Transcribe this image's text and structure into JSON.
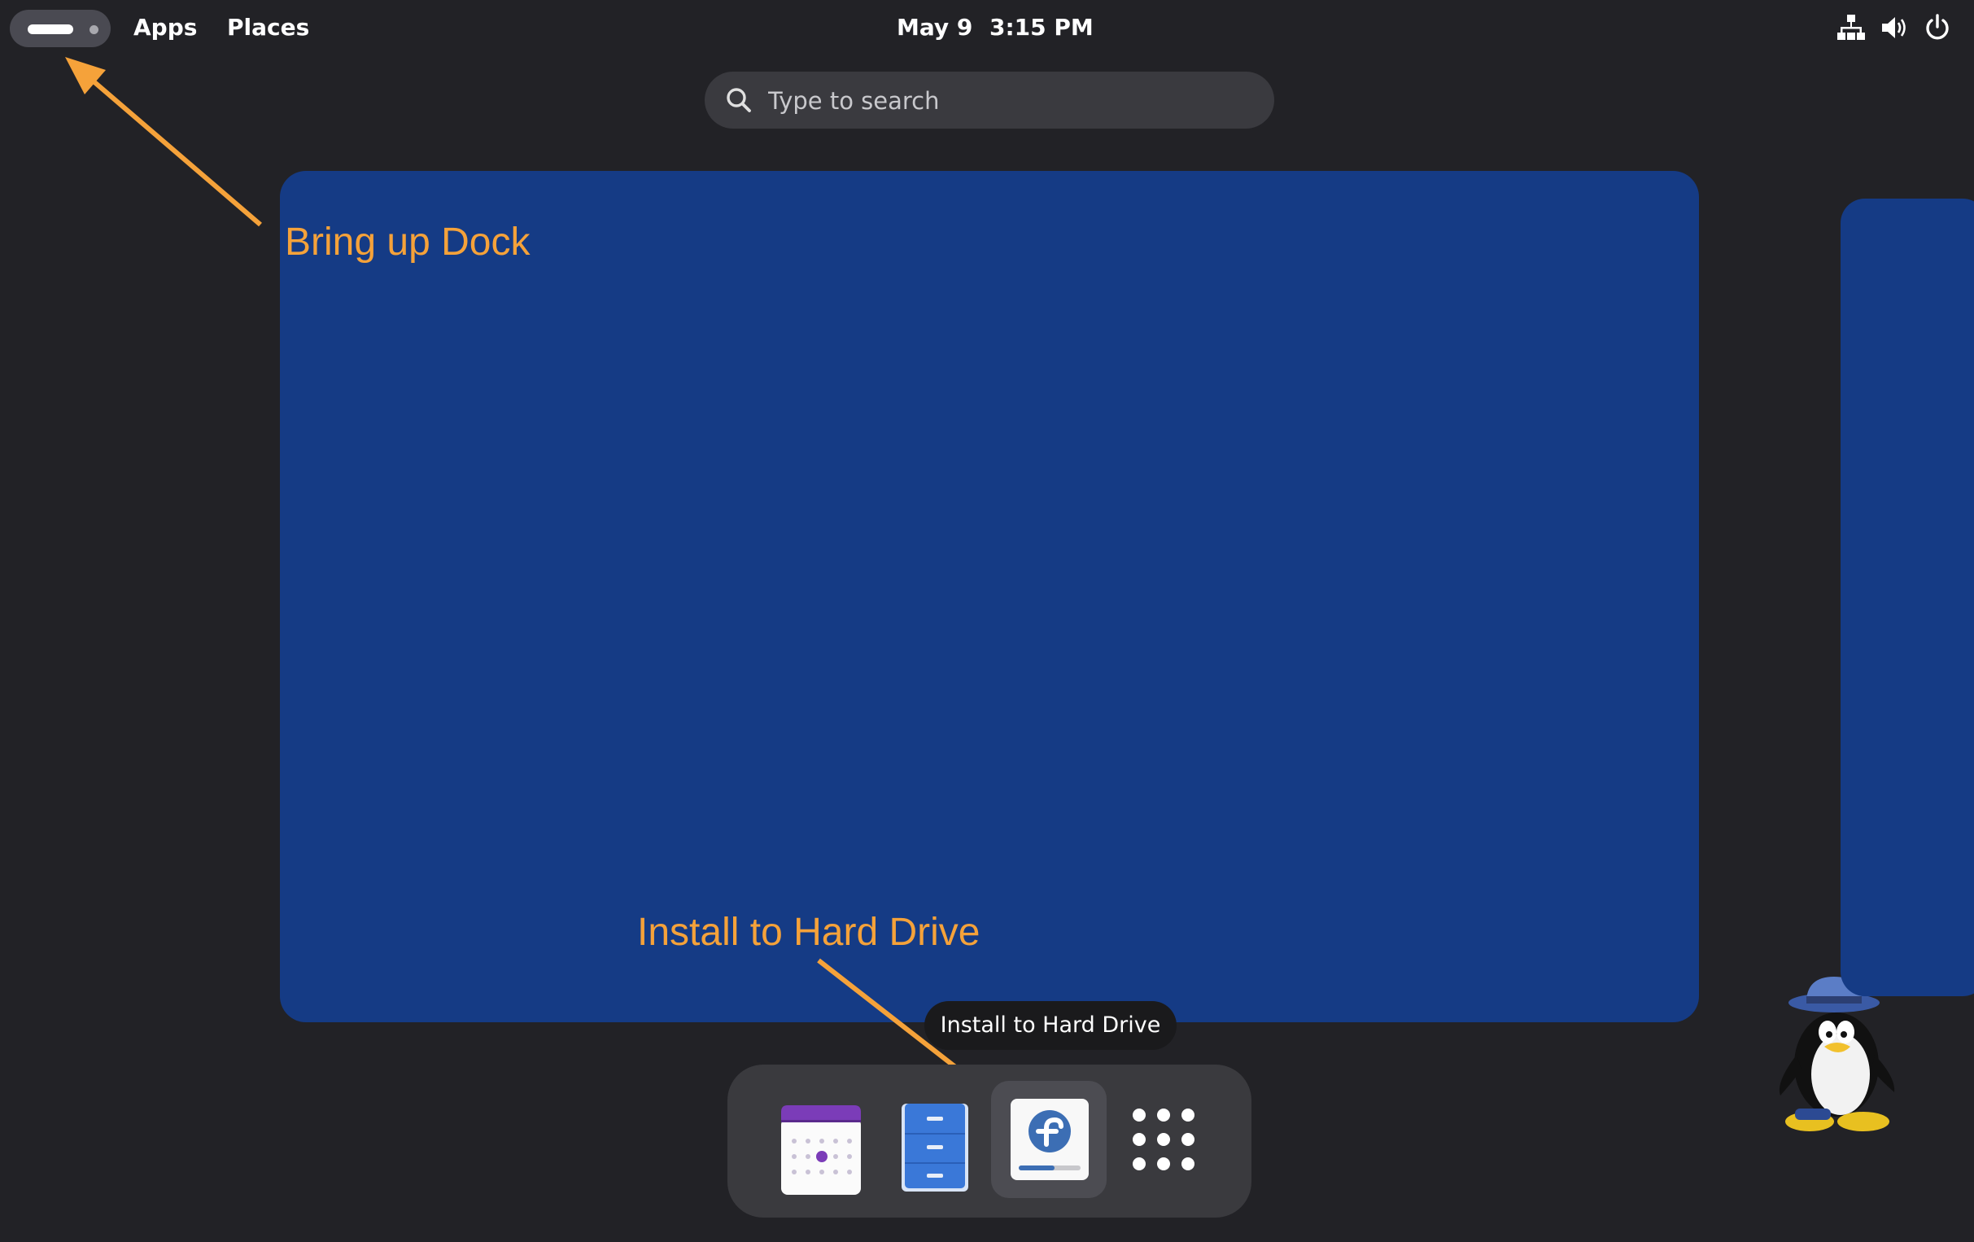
{
  "topbar": {
    "activities_label": "",
    "apps_label": "Apps",
    "places_label": "Places",
    "clock": {
      "date": "May 9",
      "time": "3:15 PM"
    },
    "tray_icons": [
      "network-icon",
      "volume-icon",
      "power-icon"
    ]
  },
  "search": {
    "placeholder": "Type to search"
  },
  "annotations": {
    "dock_hint": "Bring up Dock",
    "install_hint": "Install to Hard Drive",
    "color": "#f5a23a"
  },
  "dock": {
    "tooltip": "Install to Hard Drive",
    "items": [
      {
        "icon": "calendar-icon"
      },
      {
        "icon": "files-icon"
      },
      {
        "icon": "fedora-installer-icon",
        "active": true
      },
      {
        "icon": "app-grid-icon"
      }
    ]
  },
  "colors": {
    "panel": "#222226",
    "workspace": "#153b85",
    "dock": "#3a3a3e",
    "accent": "#f5a23a"
  }
}
